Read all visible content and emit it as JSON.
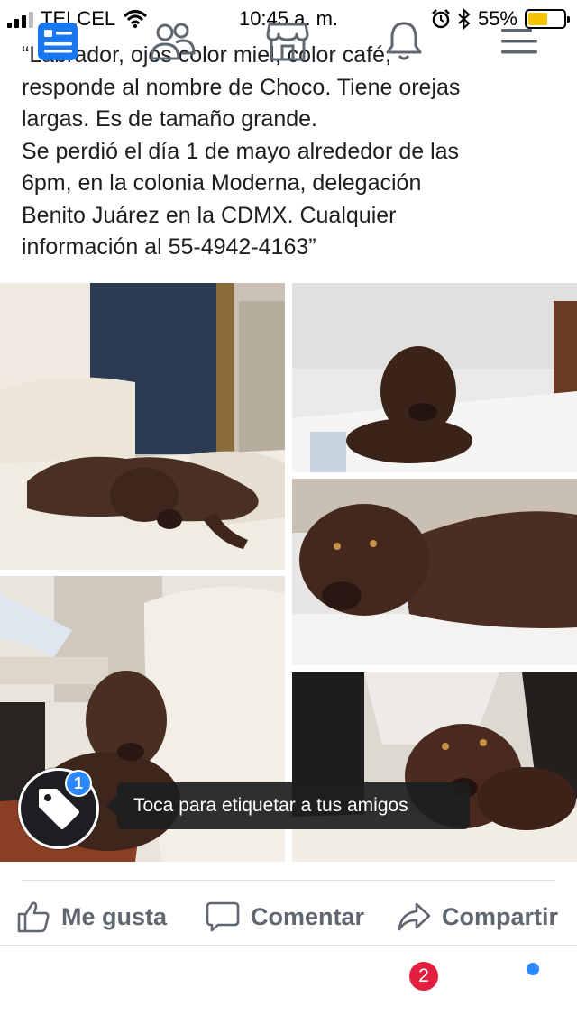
{
  "status_bar": {
    "carrier": "TELCEL",
    "time": "10:45 a. m.",
    "battery_percent": "55%",
    "battery_level": 0.55,
    "icons": [
      "signal-icon",
      "wifi-icon",
      "alarm-icon",
      "bluetooth-icon",
      "battery-icon"
    ]
  },
  "post": {
    "text": "“Labrador, ojos color miel, color café,\nresponde al nombre de Choco. Tiene orejas\nlargas. Es de tamaño grande.\nSe perdió el día 1 de mayo alrededor de las\n6pm, en la colonia Moderna, delegación\nBenito Juárez en la CDMX. Cualquier\ninformación al 55-4942-4163”"
  },
  "tag_prompt": {
    "badge_count": "1",
    "tooltip": "Toca para etiquetar a tus amigos"
  },
  "actions": {
    "like": "Me gusta",
    "comment": "Comentar",
    "share": "Compartir"
  },
  "tab_bar": {
    "notifications_badge": "2",
    "tabs": [
      "news-feed-icon",
      "friends-icon",
      "marketplace-icon",
      "notifications-icon",
      "menu-icon"
    ]
  },
  "colors": {
    "accent": "#1877f2",
    "muted": "#606770",
    "badge_red": "#e41e3f",
    "battery_yellow": "#f5c400"
  }
}
